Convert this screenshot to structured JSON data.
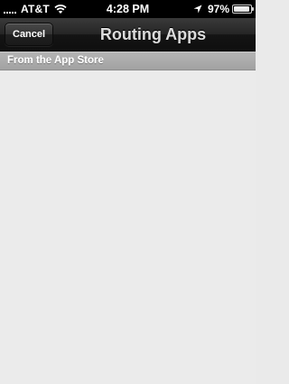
{
  "status_bar": {
    "carrier": "AT&T",
    "time": "4:28 PM",
    "battery_percent": "97%",
    "battery_level": 0.97,
    "icons": {
      "signal": "signal-strength-icon",
      "wifi": "wifi-icon",
      "location": "location-arrow-icon",
      "battery": "battery-icon"
    }
  },
  "nav_bar": {
    "cancel_label": "Cancel",
    "title": "Routing Apps"
  },
  "section": {
    "title": "From the App Store"
  }
}
